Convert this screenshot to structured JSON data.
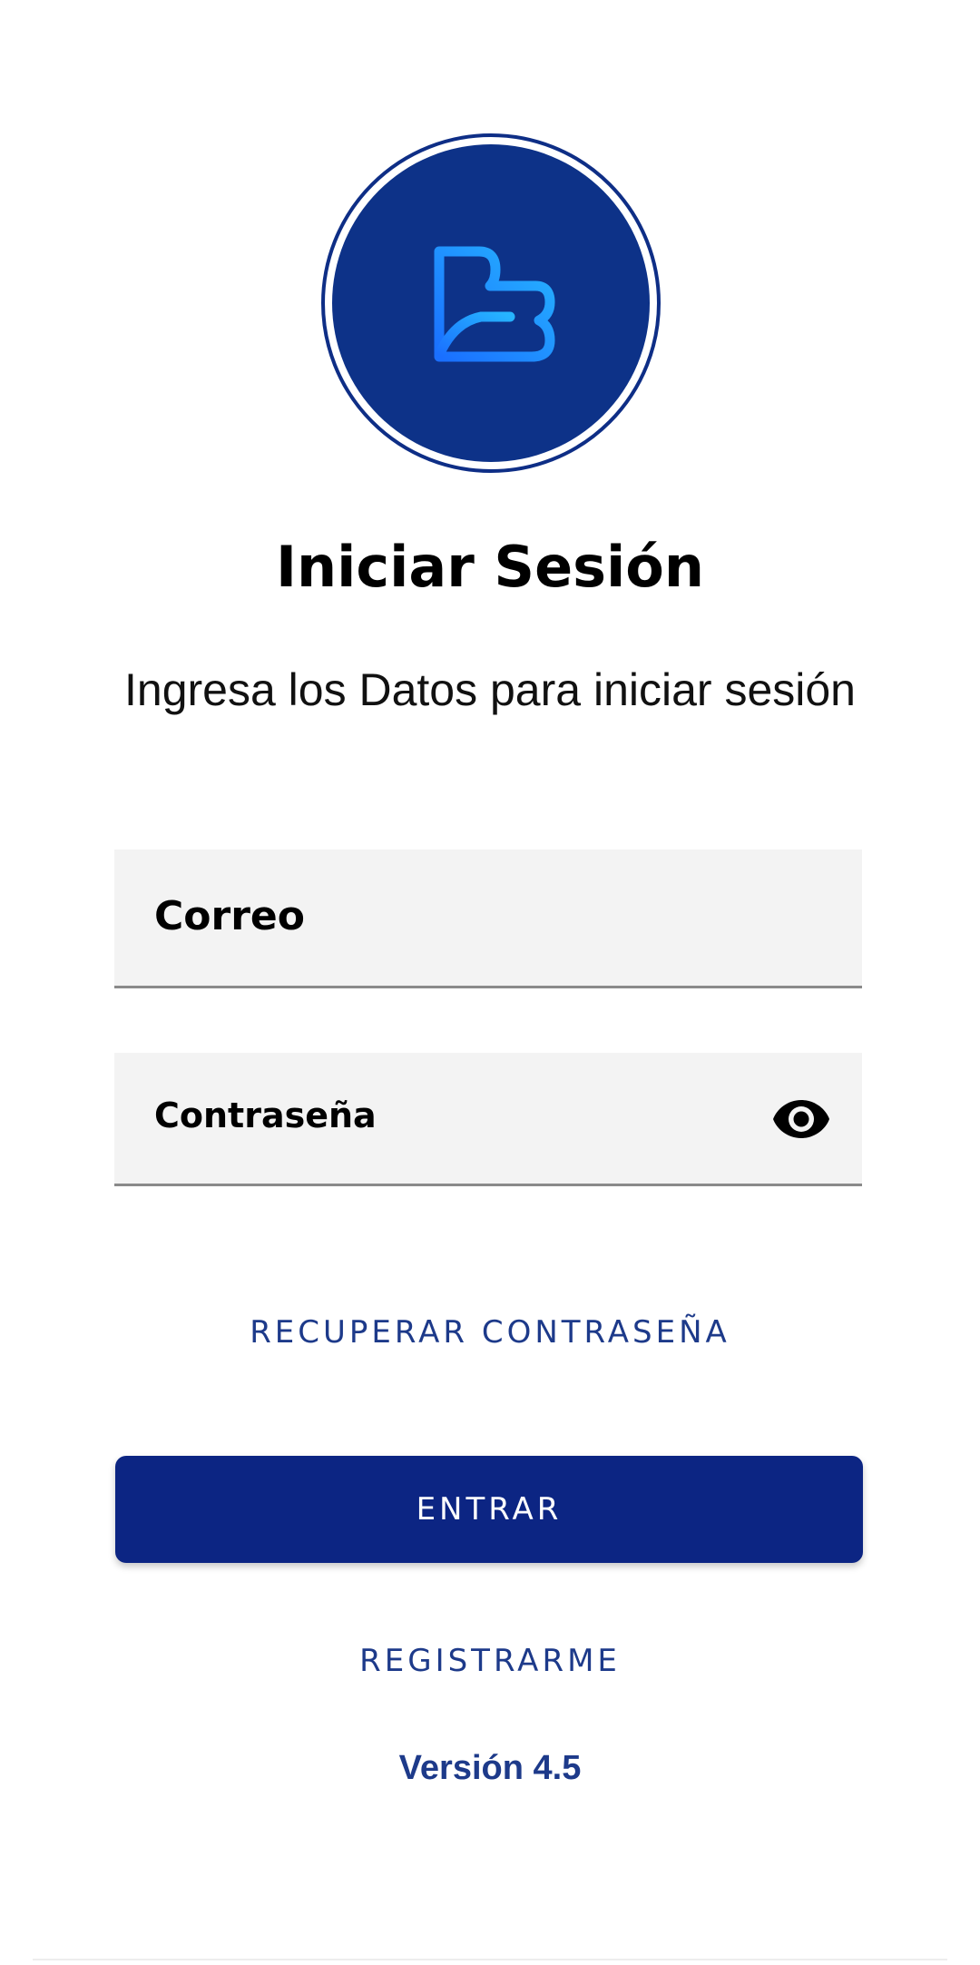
{
  "logo": {
    "icon": "b-logo-icon",
    "ring_color": "#0e2e86",
    "fill_color": "#0d3288",
    "mark_color": "#1f8bff"
  },
  "title": "Iniciar Sesión",
  "subtitle": "Ingresa los Datos para iniciar sesión",
  "form": {
    "email": {
      "label": "Correo",
      "value": ""
    },
    "password": {
      "label": "Contraseña",
      "value": "",
      "toggle_icon": "eye-icon"
    }
  },
  "links": {
    "recover": "RECUPERAR CONTRASEÑA",
    "register": "REGISTRARME"
  },
  "buttons": {
    "enter": "ENTRAR"
  },
  "version": "Versión 4.5",
  "colors": {
    "primary": "#0c2583",
    "link": "#1d3a8a",
    "field_bg": "#f3f3f3"
  }
}
